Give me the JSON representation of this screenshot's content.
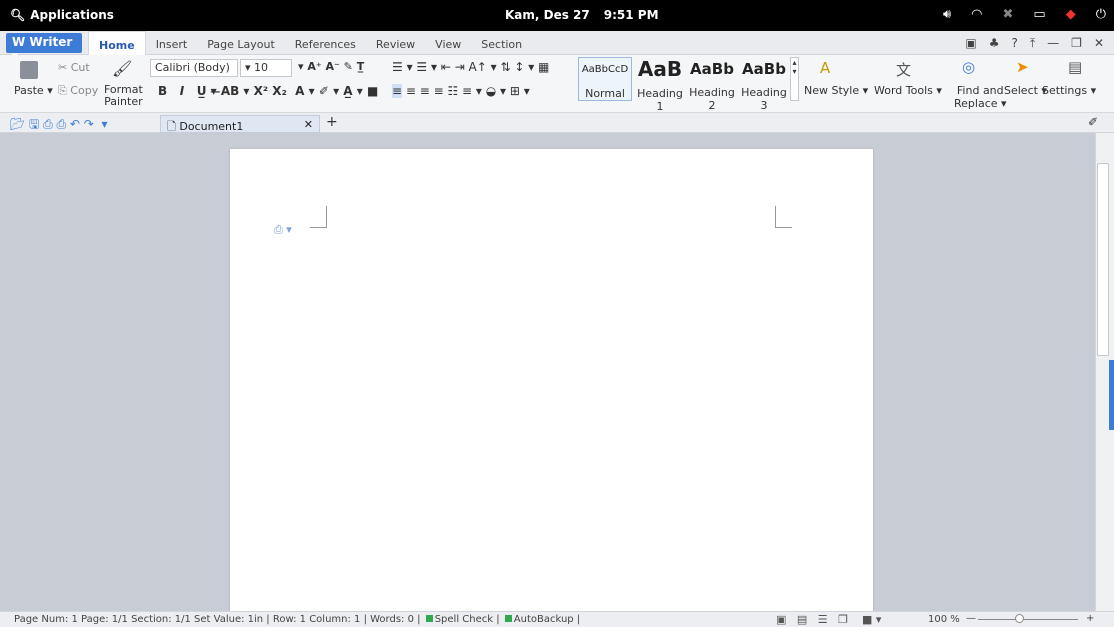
{
  "topbar": {
    "applications": "Applications",
    "date": "Kam, Des 27",
    "time": "9:51 PM"
  },
  "tabbar": {
    "app_button": "Writer",
    "tabs": [
      "Home",
      "Insert",
      "Page Layout",
      "References",
      "Review",
      "View",
      "Section"
    ]
  },
  "ribbon": {
    "paste": "Paste",
    "cut": "Cut",
    "copy": "Copy",
    "format_painter_1": "Format",
    "format_painter_2": "Painter",
    "font_name": "Calibri (Body)",
    "font_size": "10",
    "styles": [
      {
        "preview": "AaBbCcD",
        "label": "Normal"
      },
      {
        "preview": "AaB",
        "label": "Heading 1"
      },
      {
        "preview": "AaBb",
        "label": "Heading 2"
      },
      {
        "preview": "AaBb",
        "label": "Heading 3"
      }
    ],
    "new_style": "New Style",
    "word_tools": "Word Tools",
    "find_replace_1": "Find and",
    "find_replace_2": "Replace",
    "select": "Select",
    "settings": "Settings"
  },
  "document_tab": "Document1",
  "statusbar": {
    "text": "Page Num: 1   Page: 1/1   Section: 1/1   Set Value: 1in | Row: 1   Column: 1 |  Words: 0 |",
    "spell_check": "Spell Check",
    "autobackup": "AutoBackup",
    "zoom": "100 %"
  },
  "colors": {
    "accent": "#3d7bd6",
    "topbar": "#000000",
    "workspace": "#c8ccd4"
  }
}
